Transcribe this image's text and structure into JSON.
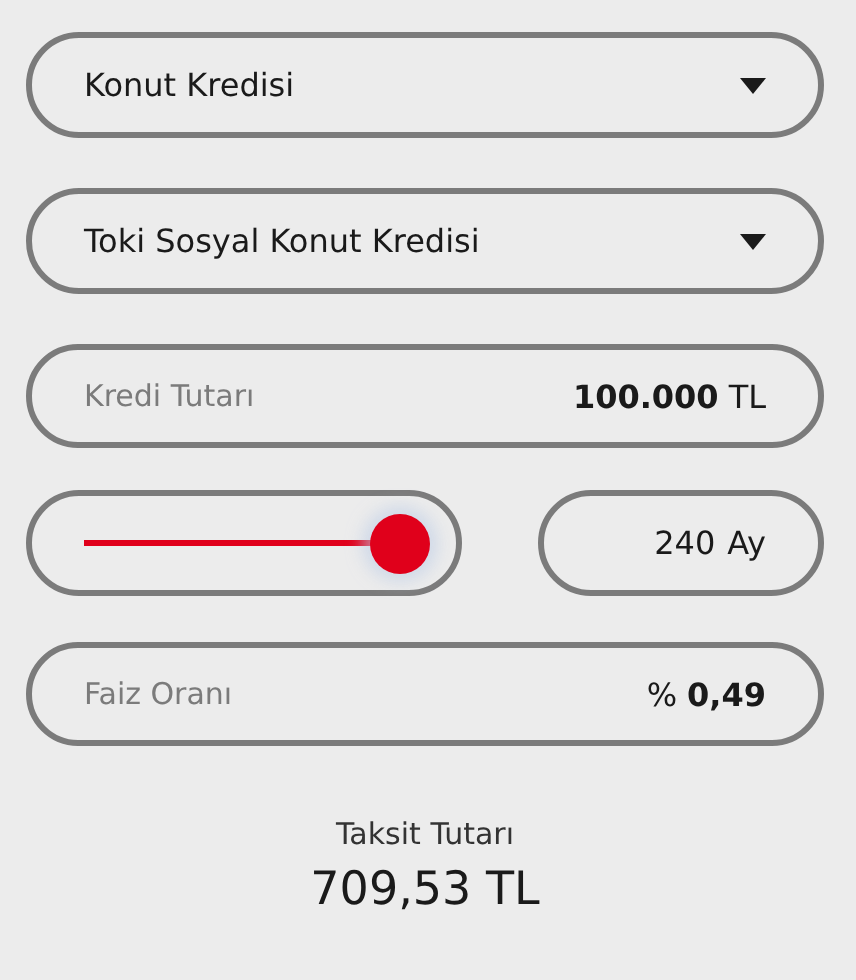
{
  "selects": [
    {
      "value": "Konut Kredisi"
    },
    {
      "value": "Toki Sosyal Konut Kredisi"
    }
  ],
  "loan_amount": {
    "label": "Kredi Tutarı",
    "value": "100.000",
    "unit": "TL"
  },
  "term": {
    "level": 1,
    "value": "240",
    "unit": "Ay"
  },
  "interest_rate": {
    "label": "Faiz Oranı",
    "prefix": "%",
    "value": "0,49"
  },
  "installment": {
    "label": "Taksit Tutarı",
    "value": "709,53 TL"
  }
}
